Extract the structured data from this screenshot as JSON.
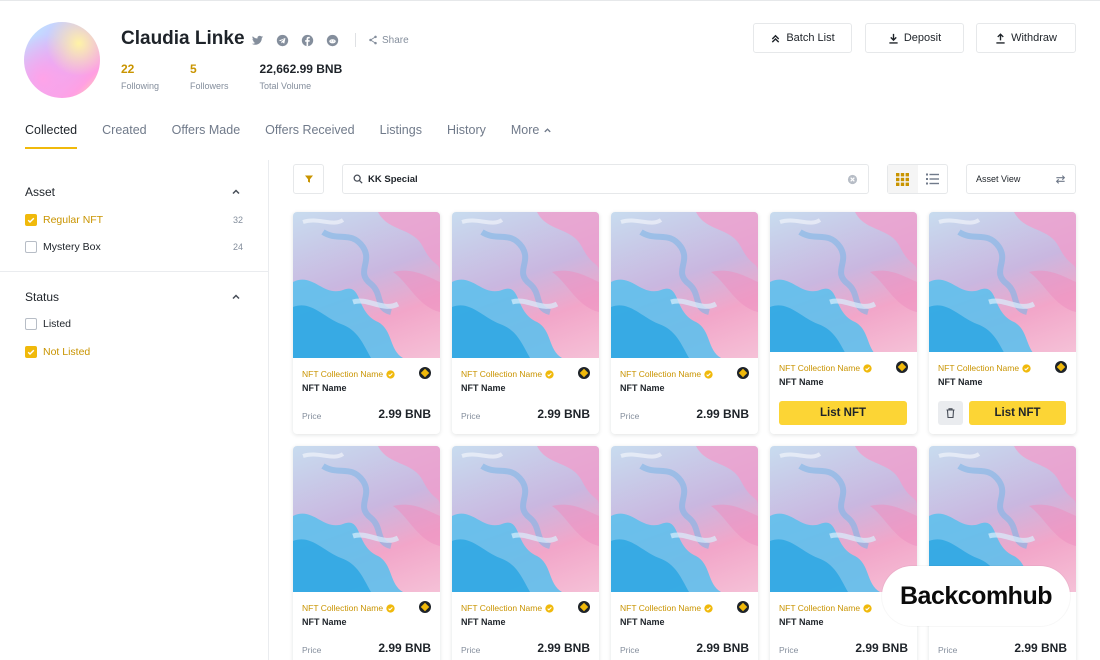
{
  "profile": {
    "name": "Claudia Linke",
    "share_label": "Share",
    "socials": [
      "twitter-icon",
      "telegram-icon",
      "facebook-icon",
      "reddit-icon"
    ],
    "stats": [
      {
        "value": "22",
        "label": "Following"
      },
      {
        "value": "5",
        "label": "Followers"
      },
      {
        "value": "22,662.99 BNB",
        "label": "Total Volume"
      }
    ]
  },
  "header_buttons": {
    "batch_list": "Batch List",
    "deposit": "Deposit",
    "withdraw": "Withdraw"
  },
  "tabs": [
    {
      "label": "Collected",
      "active": true
    },
    {
      "label": "Created"
    },
    {
      "label": "Offers Made"
    },
    {
      "label": "Offers Received"
    },
    {
      "label": "Listings"
    },
    {
      "label": "History"
    },
    {
      "label": "More"
    }
  ],
  "sidebar": {
    "asset": {
      "title": "Asset",
      "items": [
        {
          "label": "Regular NFT",
          "count": "32",
          "checked": true
        },
        {
          "label": "Mystery Box",
          "count": "24",
          "checked": false
        }
      ]
    },
    "status": {
      "title": "Status",
      "items": [
        {
          "label": "Listed",
          "checked": false
        },
        {
          "label": "Not Listed",
          "checked": true
        }
      ]
    }
  },
  "toolbar": {
    "search_value": "KK Special",
    "asset_view_label": "Asset View"
  },
  "cards": {
    "collection_name": "NFT Collection Name",
    "nft_name": "NFT Name",
    "price_label": "Price",
    "price_value": "2.99 BNB",
    "list_label": "List NFT"
  },
  "watermark": "Backcomhub",
  "colors": {
    "accent": "#f0b90b",
    "accent_text": "#c99400",
    "button_yellow": "#fcd535"
  }
}
